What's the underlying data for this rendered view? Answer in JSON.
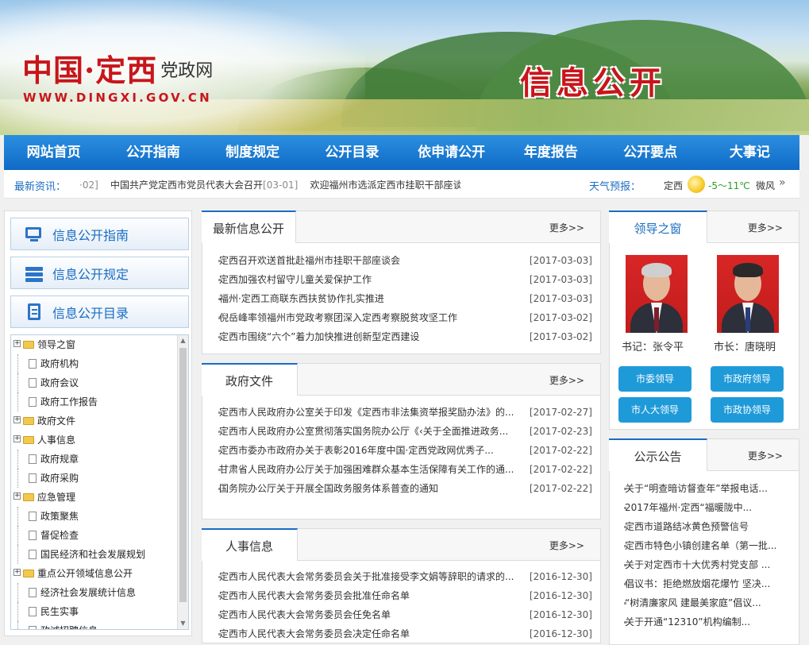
{
  "header": {
    "logo_main": "中国·定西",
    "logo_sub": "党政网",
    "logo_url": "WWW.DINGXI.GOV.CN",
    "banner_title": "信息公开"
  },
  "nav": [
    "网站首页",
    "公开指南",
    "制度规定",
    "公开目录",
    "依申请公开",
    "年度报告",
    "公开要点",
    "大事记"
  ],
  "ticker": {
    "label": "最新资讯：",
    "lead_date": "·02]",
    "item1": "中国共产党定西市党员代表大会召开",
    "item1_date": "[03-01]",
    "item2": "欢迎福州市选派定西市挂职干部座谈"
  },
  "weather": {
    "label": "天气预报：",
    "city": "定西",
    "temp": "-5～11℃",
    "wind": "微风",
    "arrow": "»"
  },
  "left": {
    "btn_guide": "信息公开指南",
    "btn_rules": "信息公开规定",
    "btn_catalog": "信息公开目录",
    "tree": [
      {
        "label": "领导之窗",
        "type": "folder",
        "expand": true
      },
      {
        "label": "政府机构",
        "type": "doc"
      },
      {
        "label": "政府会议",
        "type": "doc"
      },
      {
        "label": "政府工作报告",
        "type": "doc"
      },
      {
        "label": "政府文件",
        "type": "folder",
        "expand": true
      },
      {
        "label": "人事信息",
        "type": "folder",
        "expand": true
      },
      {
        "label": "政府规章",
        "type": "doc"
      },
      {
        "label": "政府采购",
        "type": "doc"
      },
      {
        "label": "应急管理",
        "type": "folder",
        "expand": true
      },
      {
        "label": "政策聚焦",
        "type": "doc"
      },
      {
        "label": "督促检查",
        "type": "doc"
      },
      {
        "label": "国民经济和社会发展规划",
        "type": "doc"
      },
      {
        "label": "重点公开领域信息公开",
        "type": "folder",
        "expand": true
      },
      {
        "label": "经济社会发展统计信息",
        "type": "doc"
      },
      {
        "label": "民生实事",
        "type": "doc"
      },
      {
        "label": "政诚招聘信息",
        "type": "doc"
      }
    ]
  },
  "more_label": "更多>>",
  "latest": {
    "title": "最新信息公开",
    "items": [
      {
        "t": "定西召开欢送首批赴福州市挂职干部座谈会",
        "d": "[2017-03-03]"
      },
      {
        "t": "定西加强农村留守儿童关爱保护工作",
        "d": "[2017-03-03]"
      },
      {
        "t": "福州·定西工商联东西扶贫协作扎实推进",
        "d": "[2017-03-03]"
      },
      {
        "t": "倪岳峰率领福州市党政考察团深入定西考察脱贫攻坚工作",
        "d": "[2017-03-02]"
      },
      {
        "t": "定西市围绕“六个”着力加快推进创新型定西建设",
        "d": "[2017-03-02]"
      }
    ]
  },
  "gov_docs": {
    "title": "政府文件",
    "items": [
      {
        "t": "定西市人民政府办公室关于印发《定西市非法集资举报奖励办法》的...",
        "d": "[2017-02-27]"
      },
      {
        "t": "定西市人民政府办公室贯彻落实国务院办公厅《‹关于全面推进政务...",
        "d": "[2017-02-23]"
      },
      {
        "t": "定西市委办市政府办关于表彰2016年度中国·定西党政网优秀子...",
        "d": "[2017-02-22]"
      },
      {
        "t": "甘肃省人民政府办公厅关于加强困难群众基本生活保障有关工作的通...",
        "d": "[2017-02-22]"
      },
      {
        "t": "国务院办公厅关于开展全国政务服务体系普查的通知",
        "d": "[2017-02-22]"
      }
    ]
  },
  "personnel": {
    "title": "人事信息",
    "items": [
      {
        "t": "定西市人民代表大会常务委员会关于批准接受李文娟等辞职的请求的...",
        "d": "[2016-12-30]"
      },
      {
        "t": "定西市人民代表大会常务委员会批准任命名单",
        "d": "[2016-12-30]"
      },
      {
        "t": "定西市人民代表大会常务委员会任免名单",
        "d": "[2016-12-30]"
      },
      {
        "t": "定西市人民代表大会常务委员会决定任命名单",
        "d": "[2016-12-30]"
      }
    ]
  },
  "leaders": {
    "title": "领导之窗",
    "secretary": "书记：张令平",
    "mayor": "市长：唐晓明",
    "btn1": "市委领导",
    "btn2": "市政府领导",
    "btn3": "市人大领导",
    "btn4": "市政协领导"
  },
  "notices": {
    "title": "公示公告",
    "items": [
      "关于“明查暗访督查年”举报电话...",
      "2017年福州·定西“福暖陇中...",
      "定西市道路结冰黄色预警信号",
      "定西市特色小镇创建名单（第一批...",
      "关于对定西市十大优秀村党支部 ...",
      "倡议书：拒绝燃放烟花爆竹 坚决...",
      "“树清廉家风 建最美家庭”倡议...",
      "关于开通“12310”机构编制..."
    ]
  },
  "colors": {
    "accent": "#1a6dc3",
    "nav": "#0f6ac5",
    "brand_red": "#c8151b",
    "button": "#1f9ad8"
  }
}
